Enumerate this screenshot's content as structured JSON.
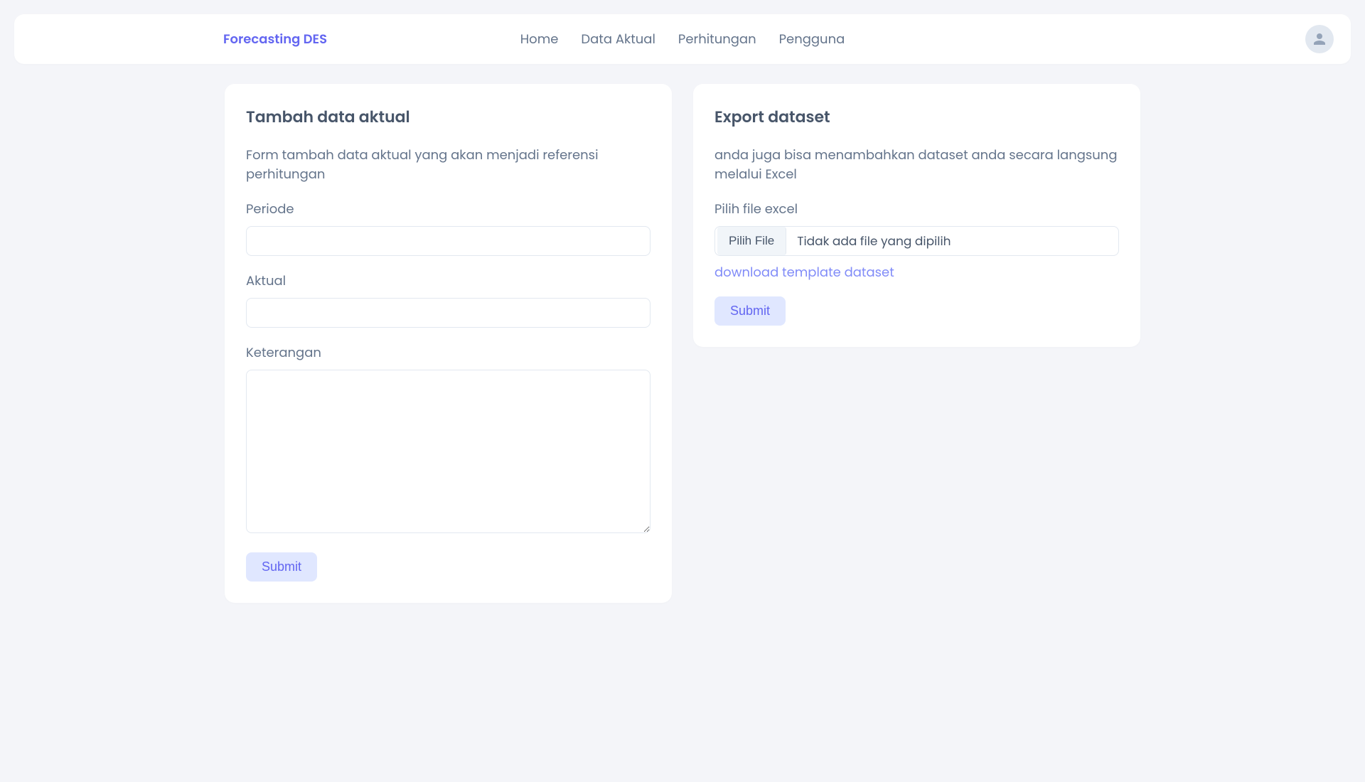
{
  "header": {
    "brand": "Forecasting DES",
    "nav": {
      "home": "Home",
      "data_aktual": "Data Aktual",
      "perhitungan": "Perhitungan",
      "pengguna": "Pengguna"
    }
  },
  "left_card": {
    "title": "Tambah data aktual",
    "desc": "Form tambah data aktual yang akan menjadi referensi perhitungan",
    "periode_label": "Periode",
    "periode_value": "",
    "aktual_label": "Aktual",
    "aktual_value": "",
    "keterangan_label": "Keterangan",
    "keterangan_value": "",
    "submit_label": "Submit"
  },
  "right_card": {
    "title": "Export dataset",
    "desc": "anda juga bisa menambahkan dataset anda secara langsung melalui Excel",
    "file_label": "Pilih file excel",
    "file_btn_label": "Pilih File",
    "file_placeholder": "Tidak ada file yang dipilih",
    "download_link": "download template dataset",
    "submit_label": "Submit"
  }
}
